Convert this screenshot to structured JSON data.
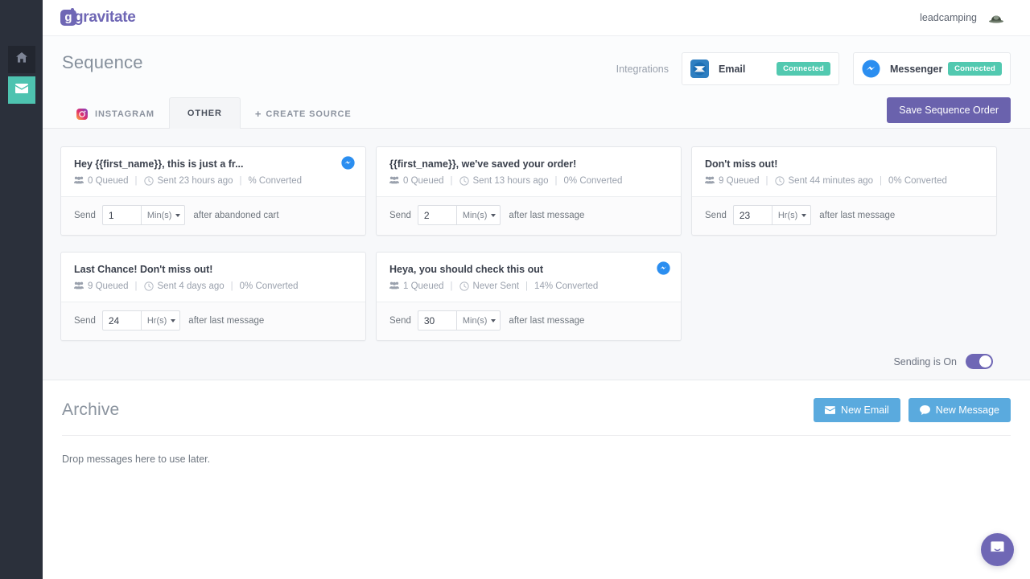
{
  "colors": {
    "rail_bg": "#2b303b",
    "rail_active": "#4ec3b0",
    "brand_purple": "#6f67b5",
    "save_button": "#6a62ad",
    "connected_green": "#52c9b0",
    "blue_button": "#5aaade",
    "page_bg": "#f7f8fa"
  },
  "rail": {
    "items": [
      {
        "icon": "home-icon",
        "name": "sidebar-item-home",
        "active": false
      },
      {
        "icon": "envelope-icon",
        "name": "sidebar-item-messages",
        "active": true
      }
    ]
  },
  "topbar": {
    "logo_badge": "g",
    "logo_text": "gravitate",
    "user_name": "leadcamping",
    "avatar_icon": "user-avatar-icon"
  },
  "page": {
    "title": "Sequence",
    "integrations_label": "Integrations",
    "integrations": [
      {
        "name": "Email",
        "icon": "email-integration-icon",
        "status": "Connected"
      },
      {
        "name": "Messenger",
        "icon": "messenger-integration-icon",
        "status": "Connected"
      }
    ],
    "tabs": [
      {
        "label": "INSTAGRAM",
        "icon": "instagram-icon",
        "active": false,
        "kind": "source"
      },
      {
        "label": "OTHER",
        "icon": null,
        "active": true,
        "kind": "source"
      },
      {
        "label": "CREATE SOURCE",
        "icon": "plus-icon",
        "active": false,
        "kind": "create"
      }
    ],
    "save_label": "Save Sequence Order"
  },
  "sequence": {
    "cards": [
      {
        "title": "Hey {{first_name}}, this is just a fr...",
        "queued": "0 Queued",
        "sent": "Sent 23 hours ago",
        "converted": "% Converted",
        "channel": "messenger",
        "send_label": "Send",
        "delay_value": "1",
        "delay_unit": "Min(s)",
        "after_text": "after abandoned cart"
      },
      {
        "title": "{{first_name}}, we've saved your order!",
        "queued": "0 Queued",
        "sent": "Sent 13 hours ago",
        "converted": "0% Converted",
        "channel": "none",
        "send_label": "Send",
        "delay_value": "2",
        "delay_unit": "Min(s)",
        "after_text": "after last message"
      },
      {
        "title": "Don't miss out!",
        "queued": "9 Queued",
        "sent": "Sent 44 minutes ago",
        "converted": "0% Converted",
        "channel": "none",
        "send_label": "Send",
        "delay_value": "23",
        "delay_unit": "Hr(s)",
        "after_text": "after last message"
      },
      {
        "title": "Last Chance! Don't miss out!",
        "queued": "9 Queued",
        "sent": "Sent 4 days ago",
        "converted": "0% Converted",
        "channel": "none",
        "send_label": "Send",
        "delay_value": "24",
        "delay_unit": "Hr(s)",
        "after_text": "after last message"
      },
      {
        "title": "Heya, you should check this out",
        "queued": "1 Queued",
        "sent": "Never Sent",
        "converted": "14% Converted",
        "channel": "messenger",
        "send_label": "Send",
        "delay_value": "30",
        "delay_unit": "Min(s)",
        "after_text": "after last message"
      }
    ],
    "sending_label": "Sending is On",
    "sending_on": true
  },
  "archive": {
    "title": "Archive",
    "new_email_label": "New Email",
    "new_message_label": "New Message",
    "empty_text": "Drop messages here to use later."
  },
  "widget": {
    "name": "intercom-launcher"
  }
}
